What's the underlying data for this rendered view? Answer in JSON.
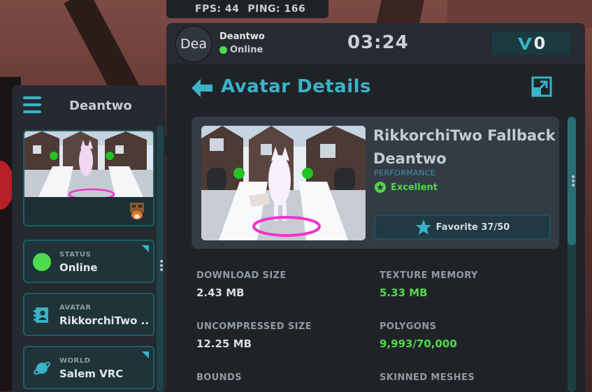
{
  "hud": {
    "fps_label": "FPS: 44",
    "ping_label": "PING: 166"
  },
  "sidebar": {
    "title": "Deantwo",
    "cards": [
      {
        "label": "STATUS",
        "value": "Online",
        "icon": "status-dot-icon"
      },
      {
        "label": "AVATAR",
        "value": "RikkorchiTwo ...",
        "icon": "avatar-card-icon"
      },
      {
        "label": "WORLD",
        "value": "Salem VRC",
        "icon": "planet-icon"
      }
    ]
  },
  "topbar": {
    "avatar_initials": "Dea",
    "user_name": "Deantwo",
    "user_status": "Online",
    "clock": "03:24",
    "credits": "0"
  },
  "panel": {
    "title": "Avatar Details",
    "avatar_name_line1": "RikkorchiTwo Fallback",
    "avatar_name_line2": "Deantwo",
    "performance_label": "PERFORMANCE",
    "performance_value": "Excellent",
    "favorite_label": "Favorite 37/50",
    "stats": [
      {
        "label": "DOWNLOAD SIZE",
        "value": "2.43 MB"
      },
      {
        "label": "TEXTURE MEMORY",
        "value": "5.33 MB"
      },
      {
        "label": "UNCOMPRESSED SIZE",
        "value": "12.25 MB"
      },
      {
        "label": "POLYGONS",
        "value": "9,993/70,000"
      },
      {
        "label": "BOUNDS",
        "value": ""
      },
      {
        "label": "SKINNED MESHES",
        "value": ""
      }
    ]
  },
  "colors": {
    "accent": "#3ab3c8",
    "good": "#52d84a",
    "online": "#4cdc4c"
  }
}
